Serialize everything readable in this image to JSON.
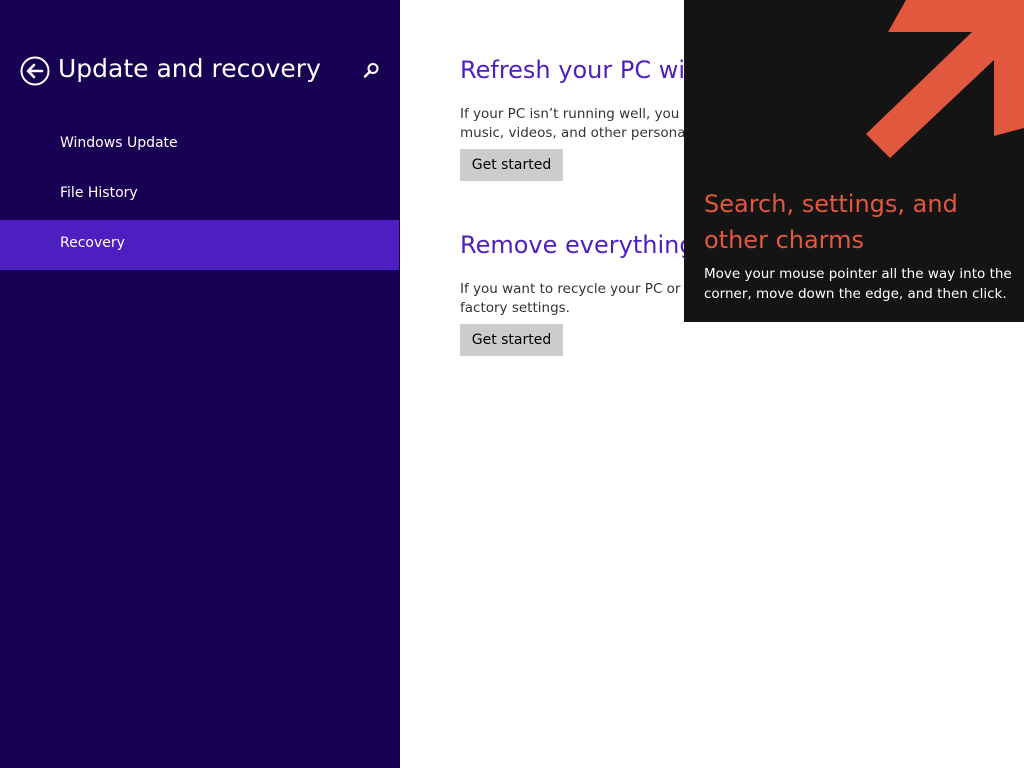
{
  "nav": {
    "title": "Update and recovery",
    "back_icon": "back-arrow-icon",
    "search_icon": "search-icon",
    "items": [
      {
        "label": "Windows Update",
        "selected": false
      },
      {
        "label": "File History",
        "selected": false
      },
      {
        "label": "Recovery",
        "selected": true
      }
    ]
  },
  "content": {
    "sections": [
      {
        "title": "Refresh your PC with",
        "description_line1": "If your PC isn’t running well, you ca",
        "description_line2": "music, videos, and other personal fi",
        "button_label": "Get started"
      },
      {
        "title": "Remove everything",
        "description_line1": "If you want to recycle your PC or st",
        "description_line2": "factory settings.",
        "button_label": "Get started"
      }
    ]
  },
  "charms_tip": {
    "arrow_icon": "arrow-up-right-icon",
    "title": "Search, settings, and other charms",
    "body": "Move your mouse pointer all the way into the corner, move down the edge, and then click."
  },
  "colors": {
    "nav_background": "#180052",
    "nav_selected": "#4d1ec0",
    "accent_title": "#4d1ec0",
    "tip_background": "#141414",
    "tip_accent": "#e2583e",
    "button_background": "#cccccc"
  }
}
